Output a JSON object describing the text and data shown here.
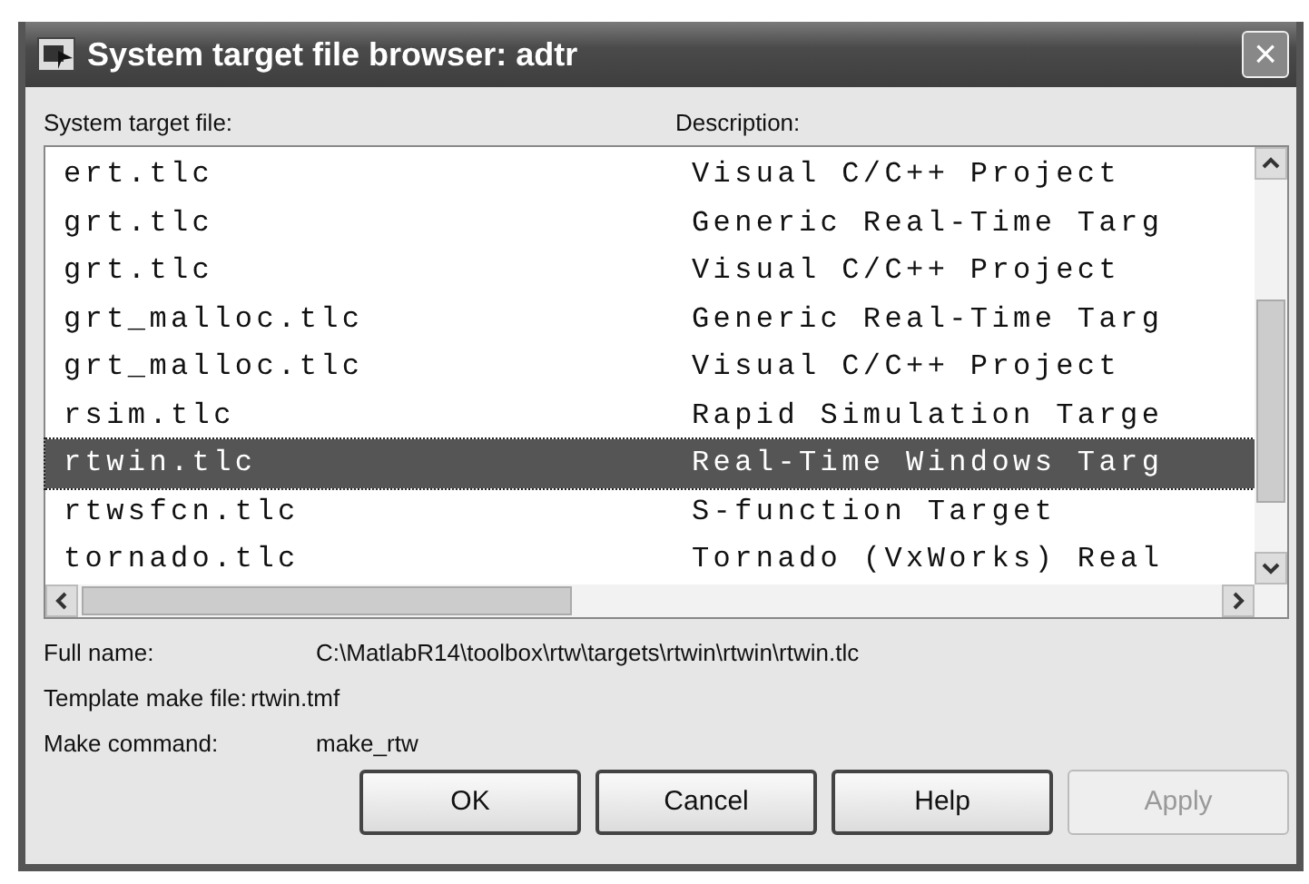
{
  "window": {
    "title": "System target file browser: adtr",
    "close": "×"
  },
  "columns": [
    "System target file:",
    "Description:"
  ],
  "rows": [
    {
      "file": "ert.tlc",
      "description": "Visual C/C++ Project",
      "selected": false
    },
    {
      "file": "grt.tlc",
      "description": "Generic Real-Time Targ",
      "selected": false
    },
    {
      "file": "grt.tlc",
      "description": "Visual C/C++ Project",
      "selected": false
    },
    {
      "file": "grt_malloc.tlc",
      "description": "Generic Real-Time Targ",
      "selected": false
    },
    {
      "file": "grt_malloc.tlc",
      "description": "Visual C/C++ Project",
      "selected": false
    },
    {
      "file": "rsim.tlc",
      "description": "Rapid Simulation Targe",
      "selected": false
    },
    {
      "file": "rtwin.tlc",
      "description": "Real-Time Windows Targ",
      "selected": true
    },
    {
      "file": "rtwsfcn.tlc",
      "description": "S-function Target",
      "selected": false
    },
    {
      "file": "tornado.tlc",
      "description": "Tornado (VxWorks) Real",
      "selected": false
    }
  ],
  "info": [
    {
      "label": "Full name:",
      "value": "C:\\MatlabR14\\toolbox\\rtw\\targets\\rtwin\\rtwin\\rtwin.tlc"
    },
    {
      "label": "Template make file:",
      "value": "rtwin.tmf"
    },
    {
      "label": "Make command:",
      "value": "make_rtw"
    }
  ],
  "buttons": [
    {
      "label": "OK",
      "disabled": false
    },
    {
      "label": "Cancel",
      "disabled": false
    },
    {
      "label": "Help",
      "disabled": false
    },
    {
      "label": "Apply",
      "disabled": true
    }
  ]
}
